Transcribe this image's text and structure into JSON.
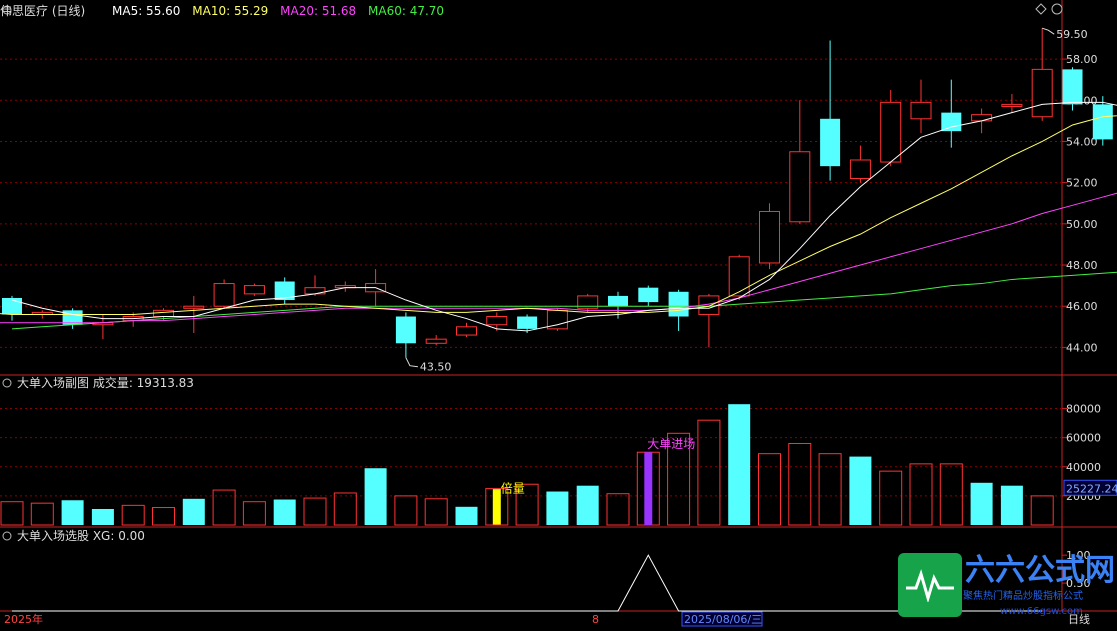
{
  "header": {
    "stock_name": "伟思医疗",
    "period": "(日线)",
    "ma_items": [
      {
        "label": "MA5: 55.60",
        "color": "#ffffff"
      },
      {
        "label": "MA10: 55.29",
        "color": "#ffff66"
      },
      {
        "label": "MA20: 51.68",
        "color": "#ff44ff"
      },
      {
        "label": "MA60: 47.70",
        "color": "#44ee44"
      }
    ]
  },
  "colors": {
    "up": "#ff3333",
    "down": "#55ffff",
    "grid": "#8b0000",
    "axis_text": "#dddddd",
    "ma5": "#ffffff",
    "ma10": "#ffff66",
    "ma20": "#ff44ff",
    "ma60": "#44ee44",
    "special_yellow": "#ffff00",
    "special_purple": "#9933ff",
    "label_magenta": "#ff44ff"
  },
  "chart_data": [
    {
      "type": "candlestick",
      "name": "main",
      "ylim": [
        43.0,
        59.8
      ],
      "yticks": [
        44,
        46,
        48,
        50,
        52,
        54,
        56,
        58
      ],
      "ytick_labels": [
        "44.00",
        "46.00",
        "48.00",
        "50.00",
        "52.00",
        "54.00",
        "56.00",
        "58.00"
      ],
      "high_label": "59.50",
      "low_label": "43.50",
      "candles": [
        {
          "o": 46.4,
          "h": 46.5,
          "l": 45.3,
          "c": 45.6
        },
        {
          "o": 45.6,
          "h": 45.8,
          "l": 45.4,
          "c": 45.7
        },
        {
          "o": 45.8,
          "h": 45.9,
          "l": 44.9,
          "c": 45.1
        },
        {
          "o": 45.1,
          "h": 45.6,
          "l": 44.4,
          "c": 45.2
        },
        {
          "o": 45.3,
          "h": 45.7,
          "l": 45.0,
          "c": 45.5
        },
        {
          "o": 45.5,
          "h": 45.9,
          "l": 45.3,
          "c": 45.8
        },
        {
          "o": 45.9,
          "h": 46.5,
          "l": 44.7,
          "c": 46.0
        },
        {
          "o": 46.0,
          "h": 47.3,
          "l": 45.9,
          "c": 47.1
        },
        {
          "o": 46.6,
          "h": 47.1,
          "l": 46.5,
          "c": 47.0
        },
        {
          "o": 47.2,
          "h": 47.4,
          "l": 46.1,
          "c": 46.3
        },
        {
          "o": 46.6,
          "h": 47.5,
          "l": 46.5,
          "c": 46.9
        },
        {
          "o": 46.9,
          "h": 47.2,
          "l": 46.7,
          "c": 47.0
        },
        {
          "o": 46.7,
          "h": 47.8,
          "l": 46.0,
          "c": 47.1
        },
        {
          "o": 45.5,
          "h": 45.7,
          "l": 43.5,
          "c": 44.2
        },
        {
          "o": 44.2,
          "h": 44.6,
          "l": 44.1,
          "c": 44.4
        },
        {
          "o": 44.6,
          "h": 45.2,
          "l": 44.5,
          "c": 45.0
        },
        {
          "o": 45.1,
          "h": 45.7,
          "l": 44.8,
          "c": 45.5
        },
        {
          "o": 45.5,
          "h": 45.6,
          "l": 44.7,
          "c": 44.9
        },
        {
          "o": 44.9,
          "h": 45.9,
          "l": 44.8,
          "c": 45.8
        },
        {
          "o": 45.9,
          "h": 46.6,
          "l": 45.7,
          "c": 46.5
        },
        {
          "o": 46.5,
          "h": 46.7,
          "l": 45.4,
          "c": 46.0
        },
        {
          "o": 46.9,
          "h": 47.0,
          "l": 46.0,
          "c": 46.2
        },
        {
          "o": 46.7,
          "h": 46.8,
          "l": 44.8,
          "c": 45.5
        },
        {
          "o": 45.6,
          "h": 46.6,
          "l": 44.0,
          "c": 46.5
        },
        {
          "o": 46.5,
          "h": 48.5,
          "l": 46.3,
          "c": 48.4
        },
        {
          "o": 48.1,
          "h": 51.0,
          "l": 47.8,
          "c": 50.6
        },
        {
          "o": 50.1,
          "h": 56.0,
          "l": 50.0,
          "c": 53.5
        },
        {
          "o": 55.1,
          "h": 58.9,
          "l": 52.1,
          "c": 52.8
        },
        {
          "o": 52.2,
          "h": 53.8,
          "l": 52.0,
          "c": 53.1
        },
        {
          "o": 53.0,
          "h": 56.5,
          "l": 52.8,
          "c": 55.9
        },
        {
          "o": 55.1,
          "h": 57.0,
          "l": 54.4,
          "c": 55.9
        },
        {
          "o": 55.4,
          "h": 57.0,
          "l": 53.7,
          "c": 54.5
        },
        {
          "o": 55.0,
          "h": 55.6,
          "l": 54.4,
          "c": 55.3
        },
        {
          "o": 55.7,
          "h": 56.3,
          "l": 55.4,
          "c": 55.8
        },
        {
          "o": 55.2,
          "h": 59.5,
          "l": 55.0,
          "c": 57.5
        },
        {
          "o": 57.5,
          "h": 57.6,
          "l": 55.5,
          "c": 55.8
        },
        {
          "o": 55.8,
          "h": 56.2,
          "l": 53.8,
          "c": 54.1
        },
        {
          "o": 54.5,
          "h": 55.1,
          "l": 54.2,
          "c": 54.8
        }
      ],
      "ma5": [
        46.3,
        45.9,
        45.6,
        45.4,
        45.4,
        45.5,
        45.5,
        45.9,
        46.3,
        46.4,
        46.6,
        46.9,
        46.9,
        46.3,
        45.8,
        45.4,
        44.9,
        44.8,
        45.1,
        45.5,
        45.6,
        45.8,
        45.9,
        45.9,
        46.4,
        47.3,
        48.8,
        50.4,
        51.8,
        53.0,
        54.2,
        54.7,
        55.0,
        55.4,
        55.8,
        55.9,
        55.9,
        55.6
      ],
      "ma10": [
        45.8,
        45.7,
        45.6,
        45.6,
        45.6,
        45.6,
        45.6,
        45.7,
        45.8,
        45.9,
        46.0,
        46.1,
        46.1,
        46.0,
        45.9,
        45.8,
        45.7,
        45.7,
        45.8,
        45.9,
        45.8,
        45.7,
        45.7,
        45.7,
        45.8,
        46.0,
        46.7,
        47.5,
        48.2,
        48.9,
        49.5,
        50.3,
        51.0,
        51.7,
        52.5,
        53.3,
        54.0,
        54.8,
        55.2,
        55.3
      ],
      "ma20": [
        45.2,
        45.2,
        45.2,
        45.2,
        45.2,
        45.3,
        45.3,
        45.4,
        45.5,
        45.6,
        45.7,
        45.8,
        45.9,
        45.9,
        45.9,
        45.9,
        45.9,
        45.9,
        45.9,
        45.9,
        45.8,
        45.8,
        45.8,
        45.9,
        46.1,
        46.4,
        46.8,
        47.2,
        47.6,
        48.0,
        48.4,
        48.8,
        49.2,
        49.6,
        50.0,
        50.5,
        50.9,
        51.3,
        51.7
      ],
      "ma60": [
        44.9,
        45.0,
        45.1,
        45.2,
        45.3,
        45.4,
        45.5,
        45.6,
        45.7,
        45.8,
        45.9,
        46.0,
        46.0,
        46.0,
        46.0,
        46.0,
        46.0,
        46.0,
        46.0,
        46.0,
        46.0,
        46.0,
        46.0,
        46.0,
        46.1,
        46.2,
        46.3,
        46.4,
        46.5,
        46.6,
        46.8,
        47.0,
        47.1,
        47.3,
        47.4,
        47.5,
        47.6,
        47.7
      ]
    },
    {
      "type": "bar",
      "name": "volume",
      "title": "大单入场副图 成交量: 19313.83",
      "ylim": [
        0,
        90000
      ],
      "yticks": [
        20000,
        40000,
        60000,
        80000
      ],
      "ytick_labels": [
        "20000",
        "40000",
        "60000",
        "80000"
      ],
      "current_value_label": "25227.24",
      "current_value": 25227.24,
      "values": [
        16000,
        15000,
        17000,
        11000,
        13500,
        12000,
        18000,
        24000,
        16000,
        17500,
        18500,
        22000,
        39000,
        20000,
        18000,
        12500,
        25000,
        28000,
        23000,
        27000,
        21500,
        50000,
        63000,
        72000,
        83000,
        49000,
        56000,
        49000,
        47000,
        37000,
        42000,
        42000,
        29000,
        27000,
        20000
      ],
      "bar_up": [
        true,
        true,
        false,
        false,
        true,
        true,
        false,
        true,
        true,
        false,
        true,
        true,
        false,
        true,
        true,
        false,
        true,
        true,
        false,
        false,
        true,
        true,
        true,
        true,
        false,
        true,
        true,
        true,
        false,
        true,
        true,
        true,
        false,
        false,
        true
      ],
      "annotations": [
        {
          "text": "倍量",
          "index": 16
        },
        {
          "text": "大单进场",
          "index": 21
        }
      ]
    },
    {
      "type": "line",
      "name": "xg",
      "title": "大单入场选股 XG: 0.00",
      "ylim": [
        0,
        1.2
      ],
      "yticks": [
        0.5,
        1.0
      ],
      "ytick_labels": [
        "0.50",
        "1.00"
      ],
      "values": [
        0,
        0,
        0,
        0,
        0,
        0,
        0,
        0,
        0,
        0,
        0,
        0,
        0,
        0,
        0,
        0,
        0,
        0,
        0,
        0,
        0,
        1,
        0,
        0,
        0,
        0,
        0,
        0,
        0,
        0,
        0,
        0,
        0,
        0,
        0
      ]
    }
  ],
  "xaxis": {
    "label_left": "2025年",
    "label_mid": "8",
    "label_date": "2025/08/06/三",
    "label_right": "日线"
  },
  "watermark": {
    "title": "六六公式网",
    "subtitle": "聚焦热门精品炒股指标公式",
    "url": "www.66gsw.com"
  }
}
